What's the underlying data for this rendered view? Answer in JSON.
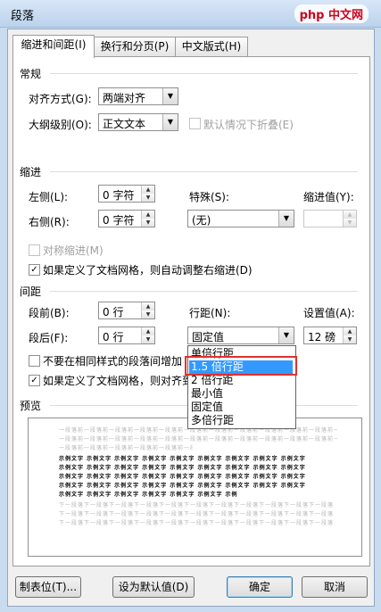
{
  "window": {
    "title": "段落",
    "watermark": "php 中文网"
  },
  "tabs": [
    {
      "label": "缩进和间距(I)"
    },
    {
      "label": "换行和分页(P)"
    },
    {
      "label": "中文版式(H)"
    }
  ],
  "general": {
    "heading": "常规",
    "alignment_label": "对齐方式(G):",
    "alignment_value": "两端对齐",
    "outline_label": "大纲级别(O):",
    "outline_value": "正文文本",
    "collapse_label": "默认情况下折叠(E)"
  },
  "indent": {
    "heading": "缩进",
    "left_label": "左侧(L):",
    "left_value": "0 字符",
    "right_label": "右侧(R):",
    "right_value": "0 字符",
    "special_label": "特殊(S):",
    "special_value": "(无)",
    "by_label": "缩进值(Y):",
    "by_value": "",
    "mirror_label": "对称缩进(M)",
    "auto_adjust_label": "如果定义了文档网格，则自动调整右缩进(D)"
  },
  "spacing": {
    "heading": "间距",
    "before_label": "段前(B):",
    "before_value": "0 行",
    "after_label": "段后(F):",
    "after_value": "0 行",
    "line_spacing_label": "行距(N):",
    "line_spacing_value": "固定值",
    "at_label": "设置值(A):",
    "at_value": "12 磅",
    "no_space_label": "不要在相同样式的段落间增加",
    "snap_grid_label": "如果定义了文档网格，则对齐到",
    "line_spacing_options": [
      "单倍行距",
      "1.5 倍行距",
      "2 倍行距",
      "最小值",
      "固定值",
      "多倍行距"
    ],
    "highlighted_option_index": 1
  },
  "preview": {
    "heading": "预览",
    "prev_text": "一段落前一段落前一段落前一段落前一段落前一段落前一段落前一段落前一段落前一段落前一段落前一段落",
    "sample_text": "示例文字 示例文字 示例文字 示例文字 示例文字 示例文字 示例文字 示例文字 示例文字",
    "next_text": "下一段落下一段落下一段落下一段落下一段落下一段落下一段落下一段落下一段落下一段落下一段落"
  },
  "buttons": {
    "tabs": "制表位(T)...",
    "set_default": "设为默认值(D)",
    "ok": "确定",
    "cancel": "取消"
  }
}
